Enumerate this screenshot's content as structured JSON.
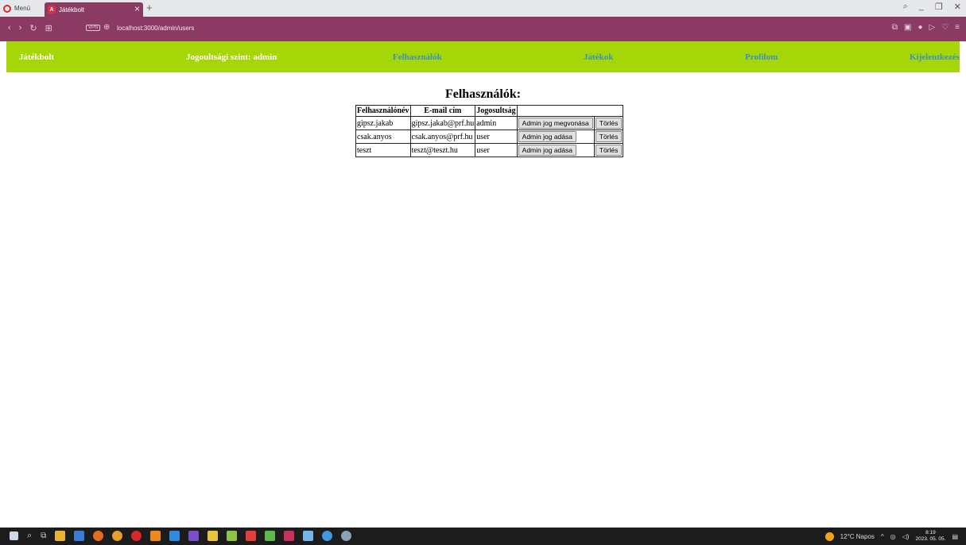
{
  "browser": {
    "menu_label": "Menü",
    "tab_title": "Játékbolt",
    "tab_favicon": "A",
    "url": "localhost:3000/admin/users",
    "vpn_label": "VPN"
  },
  "nav": {
    "brand": "Játékbolt",
    "role": "Jogoultsági szint: admin",
    "users": "Felhasználók",
    "games": "Játékok",
    "profile": "Profilom",
    "logout": "Kijelentkezés"
  },
  "page": {
    "title": "Felhasználók:"
  },
  "table": {
    "headers": [
      "Felhasználónév",
      "E-mail cím",
      "Jogosultság",
      ""
    ],
    "rows": [
      {
        "username": "gipsz.jakab",
        "email": "gipsz.jakab@prf.hu",
        "role": "admin",
        "role_action": "Admin jog megvonása",
        "delete": "Törlés"
      },
      {
        "username": "csak.anyos",
        "email": "csak.anyos@prf.hu",
        "role": "user",
        "role_action": "Admin jog adása",
        "delete": "Törlés"
      },
      {
        "username": "teszt",
        "email": "teszt@teszt.hu",
        "role": "user",
        "role_action": "Admin jog adása",
        "delete": "Törlés"
      }
    ]
  },
  "taskbar": {
    "weather": "12°C  Napos",
    "time": "8:19",
    "date": "2023. 05. 05."
  },
  "colors": {
    "browser_accent": "#8b3a63",
    "nav_bg": "#a5d608",
    "nav_link": "#3d8fc7"
  }
}
